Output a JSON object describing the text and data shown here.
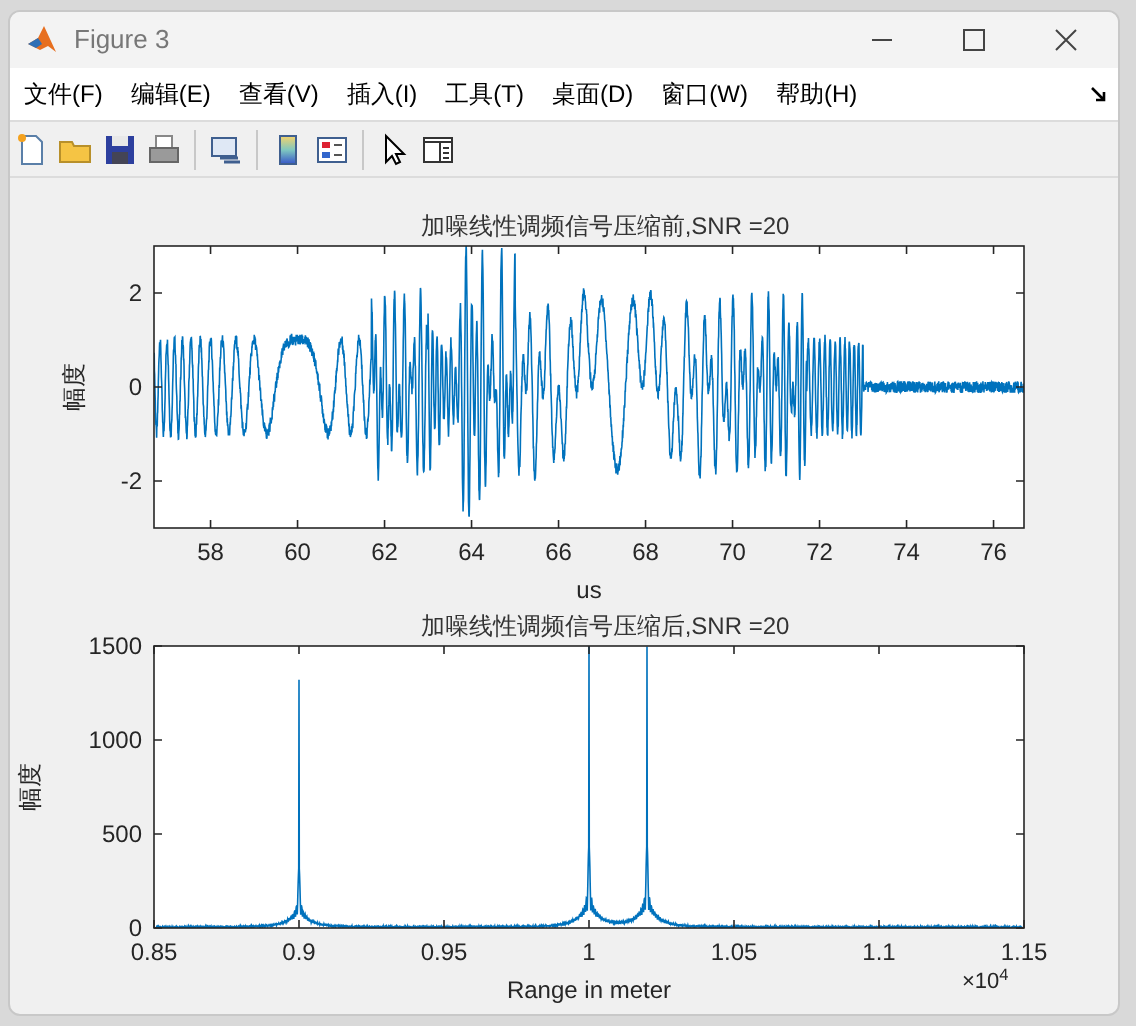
{
  "window": {
    "title": "Figure 3"
  },
  "menu": [
    {
      "label": "文件(F)"
    },
    {
      "label": "编辑(E)"
    },
    {
      "label": "查看(V)"
    },
    {
      "label": "插入(I)"
    },
    {
      "label": "工具(T)"
    },
    {
      "label": "桌面(D)"
    },
    {
      "label": "窗口(W)"
    },
    {
      "label": "帮助(H)"
    }
  ],
  "plots": [
    {
      "kind": "waveform",
      "title": "加噪线性调频信号压缩前,SNR =20",
      "xlabel": "us",
      "ylabel": "幅度",
      "xticks": [
        "58",
        "60",
        "62",
        "64",
        "66",
        "68",
        "70",
        "72",
        "74",
        "76"
      ],
      "yticks": [
        "2",
        "0",
        "-2"
      ]
    },
    {
      "kind": "spectrum",
      "title": "加噪线性调频信号压缩后,SNR =20",
      "xlabel": "Range in meter",
      "ylabel": "幅度",
      "xticks": [
        "0.85",
        "0.9",
        "0.95",
        "1",
        "1.05",
        "1.1",
        "1.15"
      ],
      "yticks": [
        "1500",
        "1000",
        "500",
        "0"
      ],
      "exponent": "×10$^{4}$"
    }
  ]
}
